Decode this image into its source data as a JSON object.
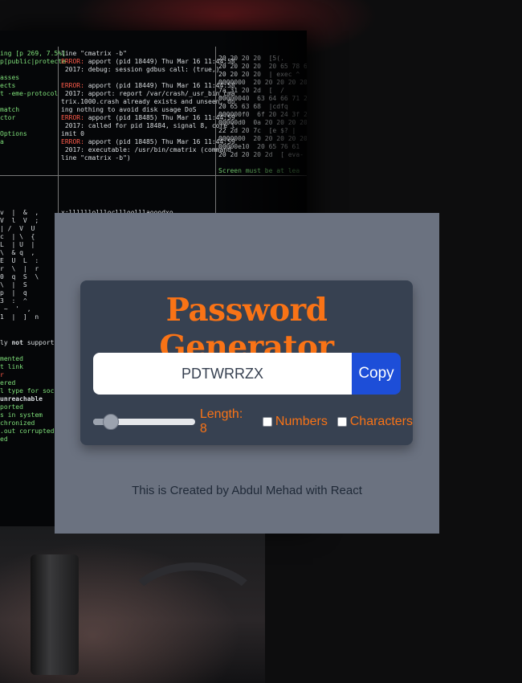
{
  "generator": {
    "title": "Password Generator",
    "password_value": "PDTWRRZX",
    "copy_label": "Copy",
    "length_label": "Length: 8",
    "length_value": 8,
    "length_min": 6,
    "length_max": 100,
    "numbers_label": "Numbers",
    "numbers_checked": false,
    "characters_label": "Characters",
    "characters_checked": false
  },
  "footer": {
    "credit": "This is Created by Abdul Mehad with React"
  },
  "colors": {
    "accent": "#f97316",
    "panel": "#374151",
    "overlay": "#6b7280",
    "copy_button": "#1d4ed8"
  }
}
